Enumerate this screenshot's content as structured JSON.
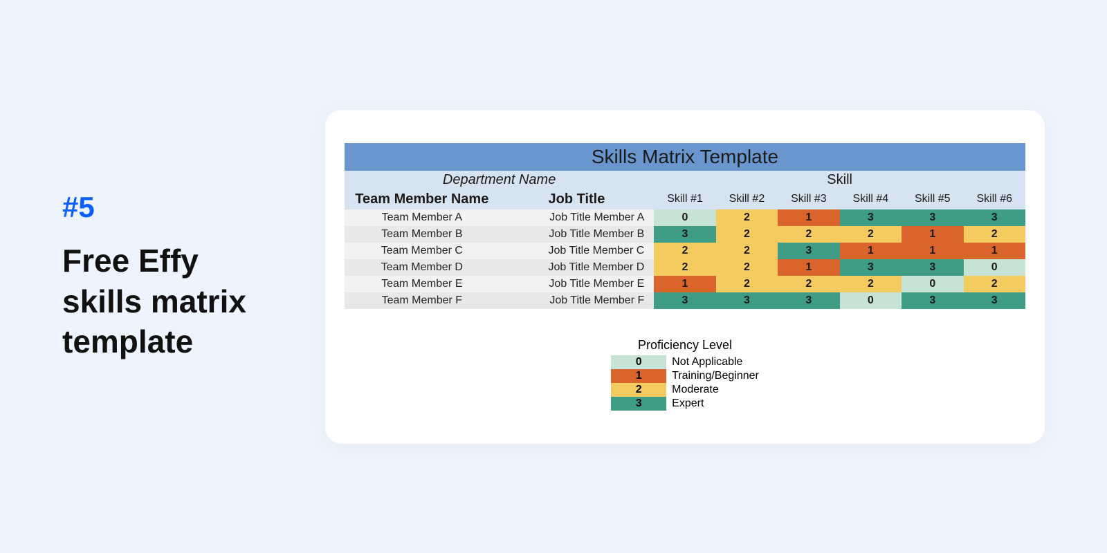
{
  "number_tag": "#5",
  "title": "Free Effy skills matrix template",
  "matrix": {
    "banner": "Skills Matrix Template",
    "dept_label": "Department Name",
    "skill_group_label": "Skill",
    "name_header": "Team Member Name",
    "job_header": "Job Title",
    "skill_headers": [
      "Skill #1",
      "Skill #2",
      "Skill #3",
      "Skill #4",
      "Skill #5",
      "Skill #6"
    ],
    "rows": [
      {
        "name": "Team Member A",
        "job": "Job Title Member A",
        "skills": [
          0,
          2,
          1,
          3,
          3,
          3
        ]
      },
      {
        "name": "Team Member B",
        "job": "Job Title Member B",
        "skills": [
          3,
          2,
          2,
          2,
          1,
          2
        ]
      },
      {
        "name": "Team Member C",
        "job": "Job Title Member C",
        "skills": [
          2,
          2,
          3,
          1,
          1,
          1
        ]
      },
      {
        "name": "Team Member D",
        "job": "Job Title Member D",
        "skills": [
          2,
          2,
          1,
          3,
          3,
          0
        ]
      },
      {
        "name": "Team Member E",
        "job": "Job Title Member E",
        "skills": [
          1,
          2,
          2,
          2,
          0,
          2
        ]
      },
      {
        "name": "Team Member F",
        "job": "Job Title Member F",
        "skills": [
          3,
          3,
          3,
          0,
          3,
          3
        ]
      }
    ]
  },
  "legend": {
    "title": "Proficiency Level",
    "items": [
      {
        "level": 0,
        "label": "Not Applicable"
      },
      {
        "level": 1,
        "label": "Training/Beginner"
      },
      {
        "level": 2,
        "label": "Moderate"
      },
      {
        "level": 3,
        "label": "Expert"
      }
    ]
  },
  "chart_data": {
    "type": "table",
    "title": "Skills Matrix Template",
    "columns": [
      "Team Member Name",
      "Job Title",
      "Skill #1",
      "Skill #2",
      "Skill #3",
      "Skill #4",
      "Skill #5",
      "Skill #6"
    ],
    "rows": [
      [
        "Team Member A",
        "Job Title Member A",
        0,
        2,
        1,
        3,
        3,
        3
      ],
      [
        "Team Member B",
        "Job Title Member B",
        3,
        2,
        2,
        2,
        1,
        2
      ],
      [
        "Team Member C",
        "Job Title Member C",
        2,
        2,
        3,
        1,
        1,
        1
      ],
      [
        "Team Member D",
        "Job Title Member D",
        2,
        2,
        1,
        3,
        3,
        0
      ],
      [
        "Team Member E",
        "Job Title Member E",
        1,
        2,
        2,
        2,
        0,
        2
      ],
      [
        "Team Member F",
        "Job Title Member F",
        3,
        3,
        3,
        0,
        3,
        3
      ]
    ],
    "legend": {
      "0": "Not Applicable",
      "1": "Training/Beginner",
      "2": "Moderate",
      "3": "Expert"
    }
  }
}
